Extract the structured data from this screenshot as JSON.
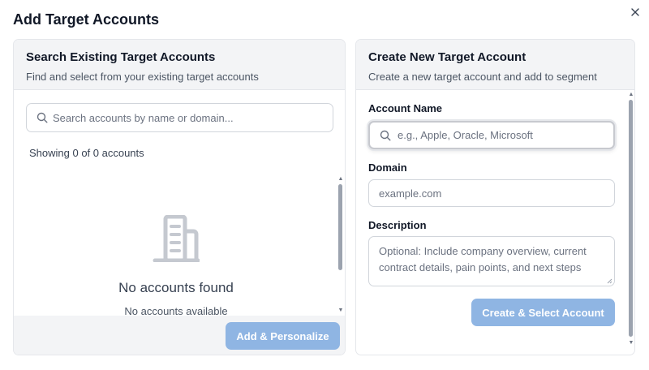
{
  "dialog": {
    "title": "Add Target Accounts"
  },
  "left_panel": {
    "title": "Search Existing Target Accounts",
    "subtitle": "Find and select from your existing target accounts",
    "search_placeholder": "Search accounts by name or domain...",
    "showing_text": "Showing 0 of 0 accounts",
    "empty_title": "No accounts found",
    "empty_subtitle": "No accounts available",
    "action_label": "Add & Personalize"
  },
  "right_panel": {
    "title": "Create New Target Account",
    "subtitle": "Create a new target account and add to segment",
    "account_name_label": "Account Name",
    "account_name_placeholder": "e.g., Apple, Oracle, Microsoft",
    "domain_label": "Domain",
    "domain_placeholder": "example.com",
    "description_label": "Description",
    "description_placeholder": "Optional: Include company overview, current contract details, pain points, and next steps",
    "submit_label": "Create & Select Account"
  },
  "colors": {
    "primary_button": "#8fb5e3",
    "panel_header_bg": "#f3f4f6"
  },
  "icons": [
    "close-icon",
    "search-icon",
    "building-icon"
  ]
}
